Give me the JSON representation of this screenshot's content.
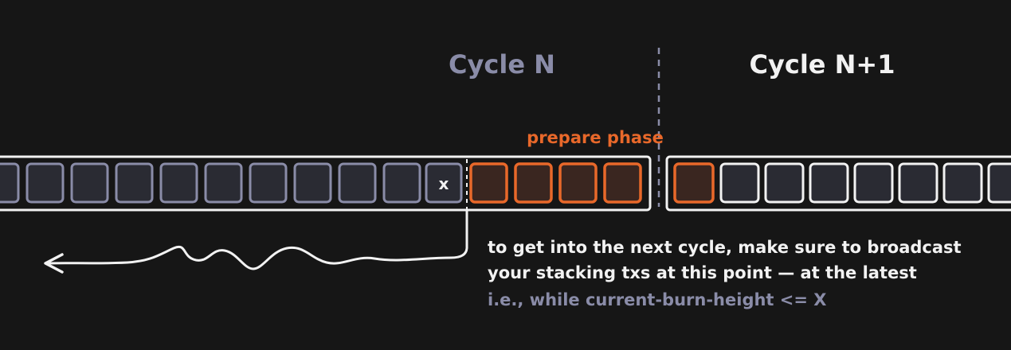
{
  "cycle_n": {
    "title": "Cycle N"
  },
  "cycle_n1": {
    "title": "Cycle N+1"
  },
  "prepare_phase": {
    "label": "prepare phase"
  },
  "cutoff_marker": {
    "symbol": "x"
  },
  "note": {
    "line1": "to get into the next cycle, make sure to broadcast",
    "line2": "your stacking txs at this point — at the latest",
    "line3": "i.e., while current-burn-height <= X"
  },
  "colors": {
    "background": "#161616",
    "muted_block": "#8a8ca8",
    "block_fill": "#2a2b33",
    "orange": "#e8682a",
    "orange_fill": "#3a2620",
    "white": "#f2f2f2"
  }
}
